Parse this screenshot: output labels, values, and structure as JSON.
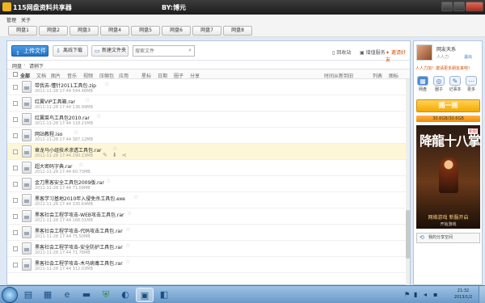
{
  "window": {
    "title": "115网盘资料共享器",
    "by": "BY:博元"
  },
  "menu": [
    "管理",
    "关于"
  ],
  "chips": [
    "网盘1",
    "网盘2",
    "网盘3",
    "网盘4",
    "网盘5",
    "网盘6",
    "网盘7",
    "网盘8"
  ],
  "toolbar": {
    "upload": "上传文件",
    "offline": "离线下载",
    "newfolder": "新建文件夹",
    "search_placeholder": "搜索文件",
    "recycle": "回收站",
    "service": "增值服务",
    "invite": "邀请好友"
  },
  "crumb": [
    "网盘",
    "请稍下"
  ],
  "filters": {
    "all": "全部",
    "items": [
      "文档",
      "图片",
      "音乐",
      "视频",
      "压缩包",
      "应用"
    ],
    "tools": [
      "星标",
      "日期",
      "圈子",
      "分享"
    ],
    "sort": "时间从新到旧",
    "views": [
      "列表",
      "图标"
    ]
  },
  "files": [
    {
      "name": "带我去-懂针2011工具包.zip",
      "meta": "2011-11-28 17:44    544.46MB"
    },
    {
      "name": "红翼VIP工具箱.rar",
      "meta": "2011-11-28 17:44    136.99MB"
    },
    {
      "name": "红翼菜鸟工具包2010.rar",
      "meta": "2011-11-28 17:44    118.21MB"
    },
    {
      "name": "网站教程.iso",
      "meta": "2011-11-28 17:44    387.12MB"
    },
    {
      "name": "章龙马小组技术渗透工具包.rar",
      "meta": "2011-11-28 17:44    290.13MB"
    },
    {
      "name": "超大密码字典.rar",
      "meta": "2011-11-28 17:44    60.73MB"
    },
    {
      "name": "金刀黑客安全工具包2009版.rar",
      "meta": "2011-11-28 17:44    71.09MB"
    },
    {
      "name": "黑客学习基地2010年入侵免杀工具包.exe",
      "meta": "2011-11-28 17:44    330.64MB"
    },
    {
      "name": "黑客社会工程学攻击-WEB攻击工具包.rar",
      "meta": "2011-11-28 17:44    166.01MB"
    },
    {
      "name": "黑客社会工程学攻击-代码攻击工具包.rar",
      "meta": "2011-11-28 17:44    75.50MB"
    },
    {
      "name": "黑客社会工程学攻击-安全防护工具包.rar",
      "meta": "2011-11-28 17:44    71.78MB"
    },
    {
      "name": "黑客社会工程学攻击-木马病毒工具包.rar",
      "meta": "2011-11-28 17:44    312.03MB"
    }
  ],
  "sidebar": {
    "username": "网友天系",
    "level": "人人力",
    "logout": "退出",
    "promo": "人人力加！邀请更多朋友来吧！",
    "icons": [
      "网盘",
      "圈子",
      "记事本",
      "更多"
    ],
    "shake": "摇一摇",
    "quota": "30.6GB/30.6GB",
    "ad": {
      "title": "降龍十八掌",
      "badge": "新服",
      "slogan": "网络游戏 新服开启",
      "sub": "开始游戏"
    },
    "share": "我的分享空间"
  },
  "clock": {
    "time": "21:32",
    "date": "2013/1/2"
  },
  "colors": {
    "accent": "#2473c4",
    "selected_row": "#fdf7d8",
    "quota": "#f08a00"
  }
}
